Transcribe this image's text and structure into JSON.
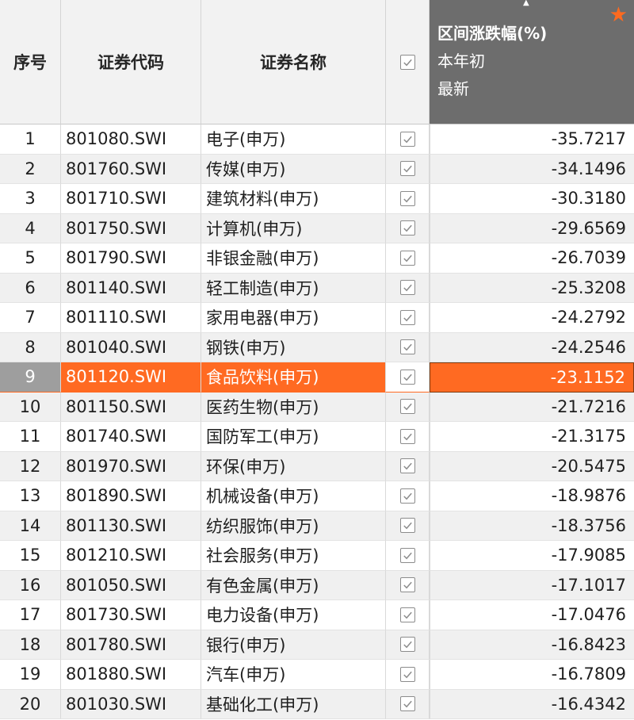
{
  "header": {
    "seq": "序号",
    "code": "证券代码",
    "name": "证券名称",
    "metric_line1": "区间涨跌幅(%)",
    "metric_line2": "本年初",
    "metric_line3": "最新",
    "star_icon": "★"
  },
  "colors": {
    "highlight": "#ff6a22",
    "header_selected": "#6d6d6d",
    "star": "#ff6a1f"
  },
  "rows": [
    {
      "seq": "1",
      "code": "801080.SWI",
      "name": "电子(申万)",
      "value": "-35.7217"
    },
    {
      "seq": "2",
      "code": "801760.SWI",
      "name": "传媒(申万)",
      "value": "-34.1496"
    },
    {
      "seq": "3",
      "code": "801710.SWI",
      "name": "建筑材料(申万)",
      "value": "-30.3180"
    },
    {
      "seq": "4",
      "code": "801750.SWI",
      "name": "计算机(申万)",
      "value": "-29.6569"
    },
    {
      "seq": "5",
      "code": "801790.SWI",
      "name": "非银金融(申万)",
      "value": "-26.7039"
    },
    {
      "seq": "6",
      "code": "801140.SWI",
      "name": "轻工制造(申万)",
      "value": "-25.3208"
    },
    {
      "seq": "7",
      "code": "801110.SWI",
      "name": "家用电器(申万)",
      "value": "-24.2792"
    },
    {
      "seq": "8",
      "code": "801040.SWI",
      "name": "钢铁(申万)",
      "value": "-24.2546"
    },
    {
      "seq": "9",
      "code": "801120.SWI",
      "name": "食品饮料(申万)",
      "value": "-23.1152"
    },
    {
      "seq": "10",
      "code": "801150.SWI",
      "name": "医药生物(申万)",
      "value": "-21.7216"
    },
    {
      "seq": "11",
      "code": "801740.SWI",
      "name": "国防军工(申万)",
      "value": "-21.3175"
    },
    {
      "seq": "12",
      "code": "801970.SWI",
      "name": "环保(申万)",
      "value": "-20.5475"
    },
    {
      "seq": "13",
      "code": "801890.SWI",
      "name": "机械设备(申万)",
      "value": "-18.9876"
    },
    {
      "seq": "14",
      "code": "801130.SWI",
      "name": "纺织服饰(申万)",
      "value": "-18.3756"
    },
    {
      "seq": "15",
      "code": "801210.SWI",
      "name": "社会服务(申万)",
      "value": "-17.9085"
    },
    {
      "seq": "16",
      "code": "801050.SWI",
      "name": "有色金属(申万)",
      "value": "-17.1017"
    },
    {
      "seq": "17",
      "code": "801730.SWI",
      "name": "电力设备(申万)",
      "value": "-17.0476"
    },
    {
      "seq": "18",
      "code": "801780.SWI",
      "name": "银行(申万)",
      "value": "-16.8423"
    },
    {
      "seq": "19",
      "code": "801880.SWI",
      "name": "汽车(申万)",
      "value": "-16.7809"
    },
    {
      "seq": "20",
      "code": "801030.SWI",
      "name": "基础化工(申万)",
      "value": "-16.4342"
    }
  ]
}
